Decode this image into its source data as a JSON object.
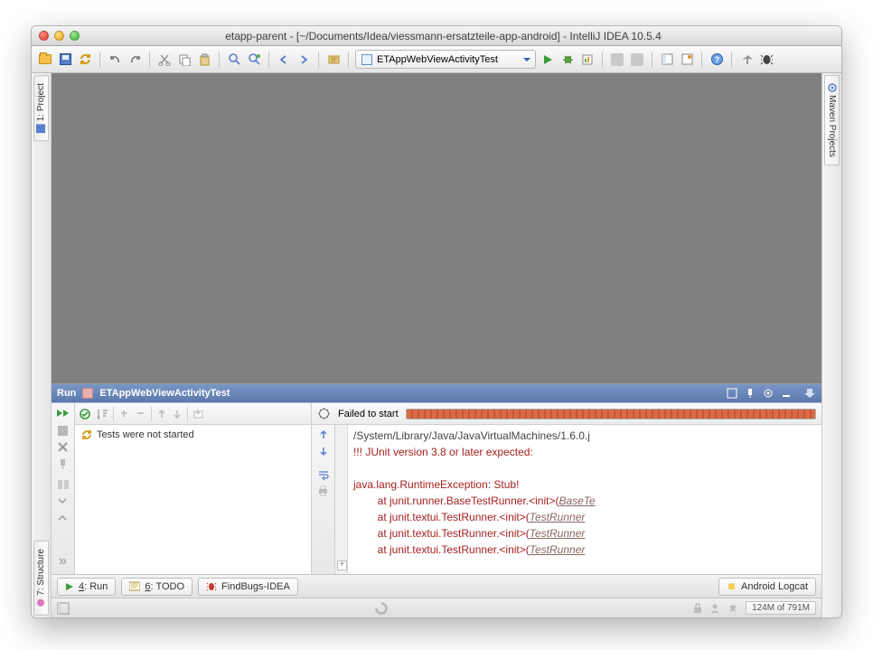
{
  "window": {
    "title": "etapp-parent - [~/Documents/Idea/viessmann-ersatzteile-app-android] - IntelliJ IDEA 10.5.4"
  },
  "toolbar": {
    "run_config": "ETAppWebViewActivityTest"
  },
  "left_tabs": {
    "project": "1: Project",
    "structure": "7: Structure"
  },
  "right_tabs": {
    "maven": "Maven Projects"
  },
  "run_panel": {
    "header": "Run",
    "tab": "ETAppWebViewActivityTest",
    "status": "Failed to start",
    "tree_msg": "Tests were not started",
    "console": {
      "l1": "/System/Library/Java/JavaVirtualMachines/1.6.0.j",
      "l2": "!!! JUnit version 3.8 or later expected:",
      "l3": "",
      "l4": "java.lang.RuntimeException: Stub!",
      "l5a": "        at junit.runner.BaseTestRunner.<init>(",
      "l5b": "BaseTe",
      "l6a": "        at junit.textui.TestRunner.<init>(",
      "l6b": "TestRunner",
      "l7a": "        at junit.textui.TestRunner.<init>(",
      "l7b": "TestRunner",
      "l8a": "        at junit.textui.TestRunner.<init>(",
      "l8b": "TestRunner"
    }
  },
  "bottom_tabs": {
    "run_pre": "4",
    "run": ": Run",
    "todo_pre": "6",
    "todo": ": TODO",
    "findbugs": "FindBugs-IDEA",
    "logcat": "Android Logcat"
  },
  "statusbar": {
    "memory": "124M of 791M"
  }
}
